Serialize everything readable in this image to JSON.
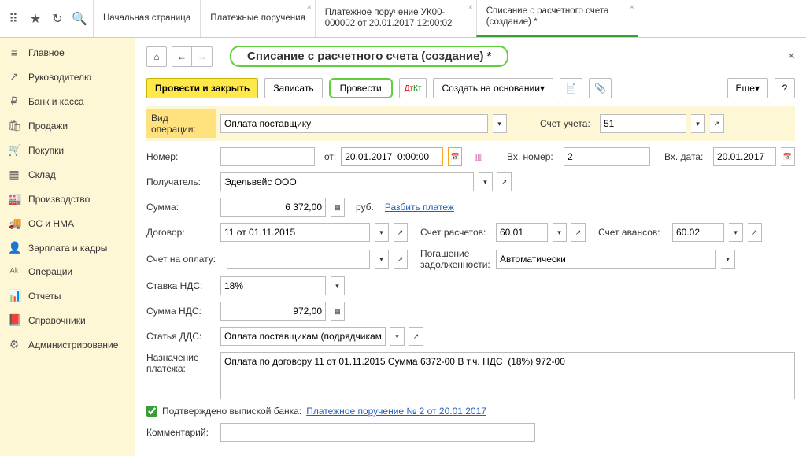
{
  "tabs": [
    {
      "label": "Начальная страница",
      "close": false
    },
    {
      "label": "Платежные поручения",
      "close": true
    },
    {
      "label": "Платежное поручение УК00-000002 от 20.01.2017 12:00:02",
      "close": true
    },
    {
      "label": "Списание с расчетного счета (создание) *",
      "close": true,
      "active": true
    }
  ],
  "sidebar": [
    {
      "icon": "≡",
      "label": "Главное"
    },
    {
      "icon": "↗",
      "label": "Руководителю"
    },
    {
      "icon": "₽",
      "label": "Банк и касса"
    },
    {
      "icon": "🛍",
      "label": "Продажи"
    },
    {
      "icon": "🛒",
      "label": "Покупки"
    },
    {
      "icon": "▦",
      "label": "Склад"
    },
    {
      "icon": "🏭",
      "label": "Производство"
    },
    {
      "icon": "🚚",
      "label": "ОС и НМА"
    },
    {
      "icon": "👤",
      "label": "Зарплата и кадры"
    },
    {
      "icon": "ᴬᵏ",
      "label": "Операции"
    },
    {
      "icon": "📊",
      "label": "Отчеты"
    },
    {
      "icon": "📕",
      "label": "Справочники"
    },
    {
      "icon": "⚙",
      "label": "Администрирование"
    }
  ],
  "title": "Списание с расчетного счета (создание) *",
  "toolbar": {
    "post_close": "Провести и закрыть",
    "save": "Записать",
    "post": "Провести",
    "create_basis": "Создать на основании",
    "more": "Еще"
  },
  "form": {
    "op_type_lbl": "Вид операции:",
    "op_type": "Оплата поставщику",
    "account_lbl": "Счет учета:",
    "account": "51",
    "number_lbl": "Номер:",
    "number": "",
    "date_lbl": "от:",
    "date": "20.01.2017  0:00:00",
    "in_number_lbl": "Вх. номер:",
    "in_number": "2",
    "in_date_lbl": "Вх. дата:",
    "in_date": "20.01.2017",
    "payee_lbl": "Получатель:",
    "payee": "Эдельвейс ООО",
    "sum_lbl": "Сумма:",
    "sum": "6 372,00",
    "currency": "руб.",
    "split_link": "Разбить платеж",
    "contract_lbl": "Договор:",
    "contract": "11 от 01.11.2015",
    "calc_acc_lbl": "Счет расчетов:",
    "calc_acc": "60.01",
    "adv_acc_lbl": "Счет авансов:",
    "adv_acc": "60.02",
    "invoice_lbl": "Счет на оплату:",
    "invoice": "",
    "debt_lbl1": "Погашение",
    "debt_lbl2": "задолженности:",
    "debt": "Автоматически",
    "vat_rate_lbl": "Ставка НДС:",
    "vat_rate": "18%",
    "vat_sum_lbl": "Сумма НДС:",
    "vat_sum": "972,00",
    "dds_lbl": "Статья ДДС:",
    "dds": "Оплата поставщикам (подрядчикам)",
    "purpose_lbl1": "Назначение",
    "purpose_lbl2": "платежа:",
    "purpose": "Оплата по договору 11 от 01.11.2015 Сумма 6372-00 В т.ч. НДС  (18%) 972-00",
    "confirmed_lbl": "Подтверждено выпиской банка:",
    "confirmed_link": "Платежное поручение № 2 от 20.01.2017",
    "comment_lbl": "Комментарий:",
    "comment": ""
  }
}
